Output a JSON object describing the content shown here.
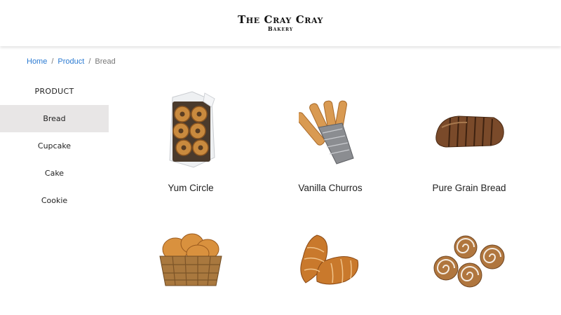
{
  "header": {
    "title": "The Cray Cray",
    "subtitle": "Bakery"
  },
  "breadcrumb": {
    "items": [
      "Home",
      "Product",
      "Bread"
    ]
  },
  "sidebar": {
    "title": "PRODUCT",
    "items": [
      {
        "label": "Bread",
        "active": true
      },
      {
        "label": "Cupcake",
        "active": false
      },
      {
        "label": "Cake",
        "active": false
      },
      {
        "label": "Cookie",
        "active": false
      }
    ]
  },
  "products": [
    {
      "name": "Yum Circle",
      "image": "bagels-in-paper-box"
    },
    {
      "name": "Vanilla Churros",
      "image": "churros-in-paper-bag"
    },
    {
      "name": "Pure Grain Bread",
      "image": "sliced-grain-loaf"
    },
    {
      "name": "",
      "image": "bread-rolls-in-basket"
    },
    {
      "name": "",
      "image": "croissants"
    },
    {
      "name": "",
      "image": "cinnamon-rolls"
    }
  ],
  "colors": {
    "link": "#2a7ad2",
    "active_bg": "#e8e6e6"
  }
}
